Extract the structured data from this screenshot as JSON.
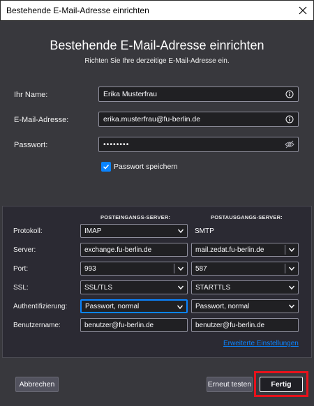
{
  "window": {
    "title": "Bestehende E-Mail-Adresse einrichten"
  },
  "header": {
    "title": "Bestehende E-Mail-Adresse einrichten",
    "subtitle": "Richten Sie Ihre derzeitige E-Mail-Adresse ein."
  },
  "account": {
    "name_label": "Ihr Name:",
    "name_value": "Erika Musterfrau",
    "email_label": "E-Mail-Adresse:",
    "email_value": "erika.musterfrau@fu-berlin.de",
    "password_label": "Passwort:",
    "password_value": "••••••••",
    "remember_label": "Passwort speichern",
    "remember_checked": true
  },
  "servers": {
    "incoming_header": "POSTEINGANGS-SERVER:",
    "outgoing_header": "POSTAUSGANGS-SERVER:",
    "rows": {
      "protocol": {
        "label": "Protokoll:",
        "in": "IMAP",
        "out": "SMTP"
      },
      "server": {
        "label": "Server:",
        "in": "exchange.fu-berlin.de",
        "out": "mail.zedat.fu-berlin.de"
      },
      "port": {
        "label": "Port:",
        "in": "993",
        "out": "587"
      },
      "ssl": {
        "label": "SSL:",
        "in": "SSL/TLS",
        "out": "STARTTLS"
      },
      "auth": {
        "label": "Authentifizierung:",
        "in": "Passwort, normal",
        "out": "Passwort, normal"
      },
      "username": {
        "label": "Benutzername:",
        "in": "benutzer@fu-berlin.de",
        "out": "benutzer@fu-berlin.de"
      }
    },
    "advanced_link": "Erweiterte Einstellungen"
  },
  "footer": {
    "cancel_label": "Abbrechen",
    "retest_label": "Erneut testen",
    "done_label": "Fertig"
  },
  "colors": {
    "background": "#38383d",
    "accent": "#0a84ff",
    "highlight_box": "#e8121b"
  }
}
